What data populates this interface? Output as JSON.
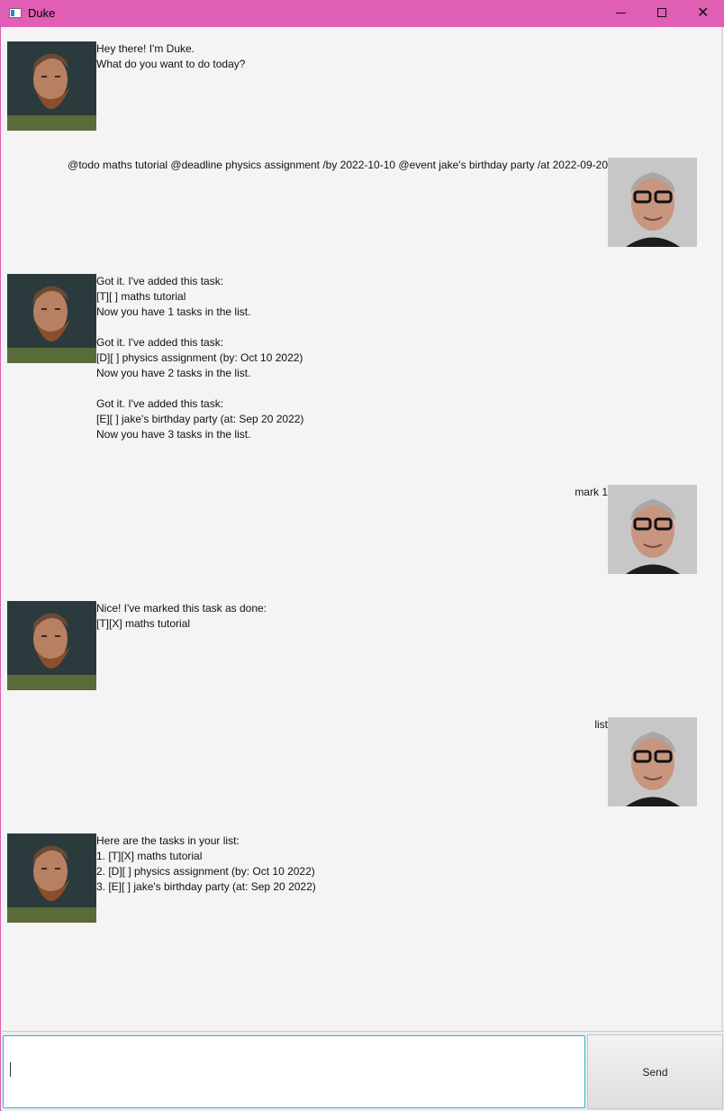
{
  "window": {
    "title": "Duke",
    "min_glyph": "",
    "close_glyph": "✕"
  },
  "messages": [
    {
      "sender": "duke",
      "lines": [
        "Hey there! I'm Duke.",
        "What do you want to do today?"
      ]
    },
    {
      "sender": "user",
      "lines": [
        "@todo maths tutorial @deadline physics assignment /by 2022-10-10 @event jake's birthday party /at 2022-09-20"
      ]
    },
    {
      "sender": "duke",
      "lines": [
        "Got it. I've added this task:",
        "[T][ ] maths tutorial",
        "Now you have 1 tasks in the list.",
        "",
        "Got it. I've added this task:",
        "[D][ ] physics assignment (by: Oct 10 2022)",
        "Now you have 2 tasks in the list.",
        "",
        "Got it. I've added this task:",
        "[E][ ] jake's birthday party (at: Sep 20 2022)",
        "Now you have 3 tasks in the list."
      ]
    },
    {
      "sender": "user",
      "lines": [
        "mark 1"
      ]
    },
    {
      "sender": "duke",
      "lines": [
        "Nice! I've marked this task as done:",
        "[T][X] maths tutorial"
      ]
    },
    {
      "sender": "user",
      "lines": [
        "list"
      ]
    },
    {
      "sender": "duke",
      "lines": [
        "Here are the tasks in your list:",
        "1. [T][X] maths tutorial",
        "2. [D][ ] physics assignment (by: Oct 10 2022)",
        "3. [E][ ] jake's birthday party (at: Sep 20 2022)"
      ]
    }
  ],
  "input": {
    "value": "",
    "placeholder": ""
  },
  "send_label": "Send",
  "colors": {
    "titlebar": "#e05eb3",
    "background": "#f4f4f4",
    "input_border": "#3fa9d9"
  }
}
